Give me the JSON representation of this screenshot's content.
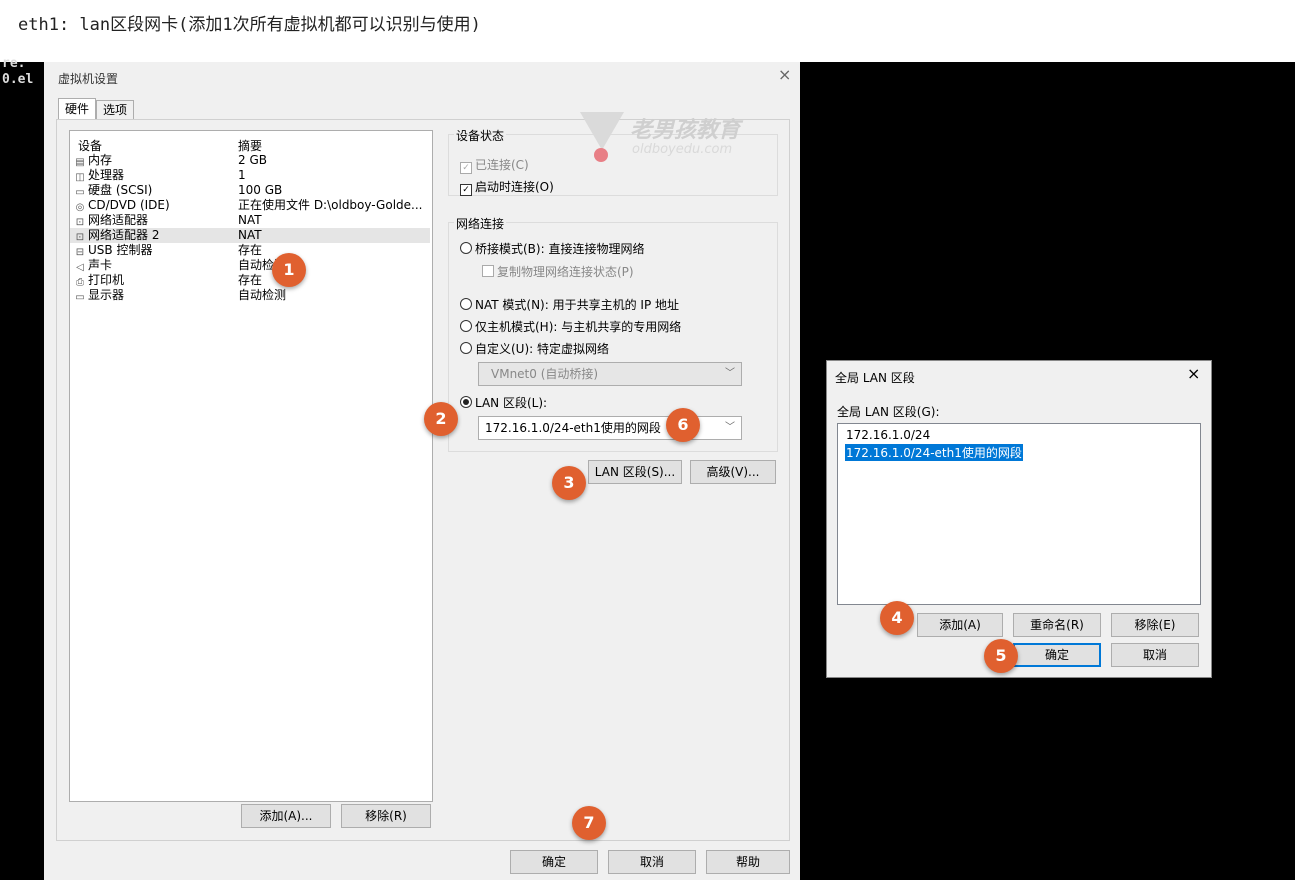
{
  "caption": "eth1: lan区段网卡(添加1次所有虚拟机都可以识别与使用)",
  "terminal": {
    "lines": [
      "re.",
      "0.el"
    ]
  },
  "vm_settings": {
    "title": "虚拟机设置",
    "close": "×",
    "tabs": [
      "硬件",
      "选项"
    ],
    "device_header": {
      "device": "设备",
      "summary": "摘要"
    },
    "devices": [
      {
        "icon": "memory-icon",
        "glyph": "▤",
        "name": "内存",
        "summary": "2 GB"
      },
      {
        "icon": "cpu-icon",
        "glyph": "◫",
        "name": "处理器",
        "summary": "1"
      },
      {
        "icon": "disk-icon",
        "glyph": "▭",
        "name": "硬盘 (SCSI)",
        "summary": "100 GB"
      },
      {
        "icon": "cd-icon",
        "glyph": "◎",
        "name": "CD/DVD (IDE)",
        "summary": "正在使用文件 D:\\oldboy-Golde..."
      },
      {
        "icon": "network-icon",
        "glyph": "⊡",
        "name": "网络适配器",
        "summary": "NAT"
      },
      {
        "icon": "network-icon",
        "glyph": "⊡",
        "name": "网络适配器 2",
        "summary": "NAT"
      },
      {
        "icon": "usb-icon",
        "glyph": "⊟",
        "name": "USB 控制器",
        "summary": "存在"
      },
      {
        "icon": "speaker-icon",
        "glyph": "◁",
        "name": "声卡",
        "summary": "自动检测"
      },
      {
        "icon": "printer-icon",
        "glyph": "⎙",
        "name": "打印机",
        "summary": "存在"
      },
      {
        "icon": "monitor-icon",
        "glyph": "▭",
        "name": "显示器",
        "summary": "自动检测"
      }
    ],
    "add_button": "添加(A)...",
    "remove_button": "移除(R)",
    "device_status": {
      "label": "设备状态",
      "connected": "已连接(C)",
      "connect_at_power_on": "启动时连接(O)"
    },
    "network": {
      "label": "网络连接",
      "bridged": "桥接模式(B): 直接连接物理网络",
      "replicate": "复制物理网络连接状态(P)",
      "nat": "NAT 模式(N): 用于共享主机的 IP 地址",
      "host_only": "仅主机模式(H): 与主机共享的专用网络",
      "custom": "自定义(U): 特定虚拟网络",
      "custom_value": "VMnet0 (自动桥接)",
      "lan_segment": "LAN 区段(L):",
      "lan_value": "172.16.1.0/24-eth1使用的网段"
    },
    "lan_segments_button": "LAN 区段(S)...",
    "advanced_button": "高级(V)...",
    "ok": "确定",
    "cancel": "取消",
    "help": "帮助"
  },
  "lan_dialog": {
    "title": "全局 LAN 区段",
    "close": "×",
    "list_label": "全局 LAN 区段(G):",
    "items": [
      "172.16.1.0/24",
      "172.16.1.0/24-eth1使用的网段"
    ],
    "add": "添加(A)",
    "rename": "重命名(R)",
    "remove": "移除(E)",
    "ok": "确定",
    "cancel": "取消"
  },
  "markers": [
    "1",
    "2",
    "3",
    "4",
    "5",
    "6",
    "7"
  ],
  "watermark": {
    "brand": "老男孩教育",
    "site": "oldboyedu.com"
  }
}
